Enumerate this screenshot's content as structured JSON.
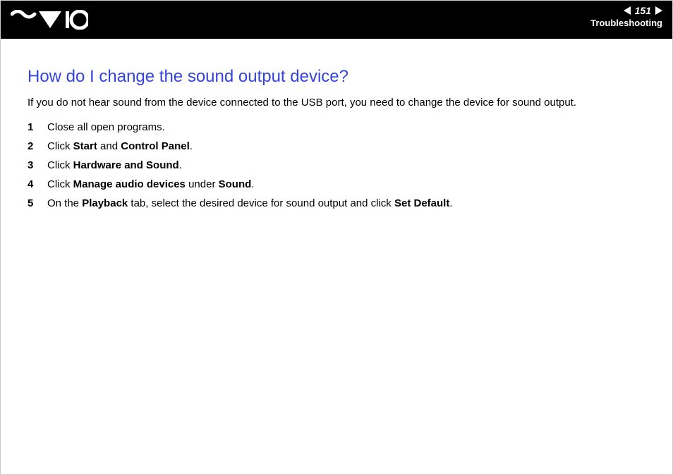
{
  "header": {
    "page_number": "151",
    "section": "Troubleshooting"
  },
  "content": {
    "title": "How do I change the sound output device?",
    "intro": "If you do not hear sound from the device connected to the USB port, you need to change the device for sound output.",
    "steps": [
      {
        "num": "1",
        "parts": [
          {
            "t": "Close all open programs."
          }
        ]
      },
      {
        "num": "2",
        "parts": [
          {
            "t": "Click "
          },
          {
            "b": "Start"
          },
          {
            "t": " and "
          },
          {
            "b": "Control Panel"
          },
          {
            "t": "."
          }
        ]
      },
      {
        "num": "3",
        "parts": [
          {
            "t": "Click "
          },
          {
            "b": "Hardware and Sound"
          },
          {
            "t": "."
          }
        ]
      },
      {
        "num": "4",
        "parts": [
          {
            "t": "Click "
          },
          {
            "b": "Manage audio devices"
          },
          {
            "t": " under "
          },
          {
            "b": "Sound"
          },
          {
            "t": "."
          }
        ]
      },
      {
        "num": "5",
        "parts": [
          {
            "t": "On the "
          },
          {
            "b": "Playback"
          },
          {
            "t": " tab, select the desired device for sound output and click "
          },
          {
            "b": "Set Default"
          },
          {
            "t": "."
          }
        ]
      }
    ]
  }
}
